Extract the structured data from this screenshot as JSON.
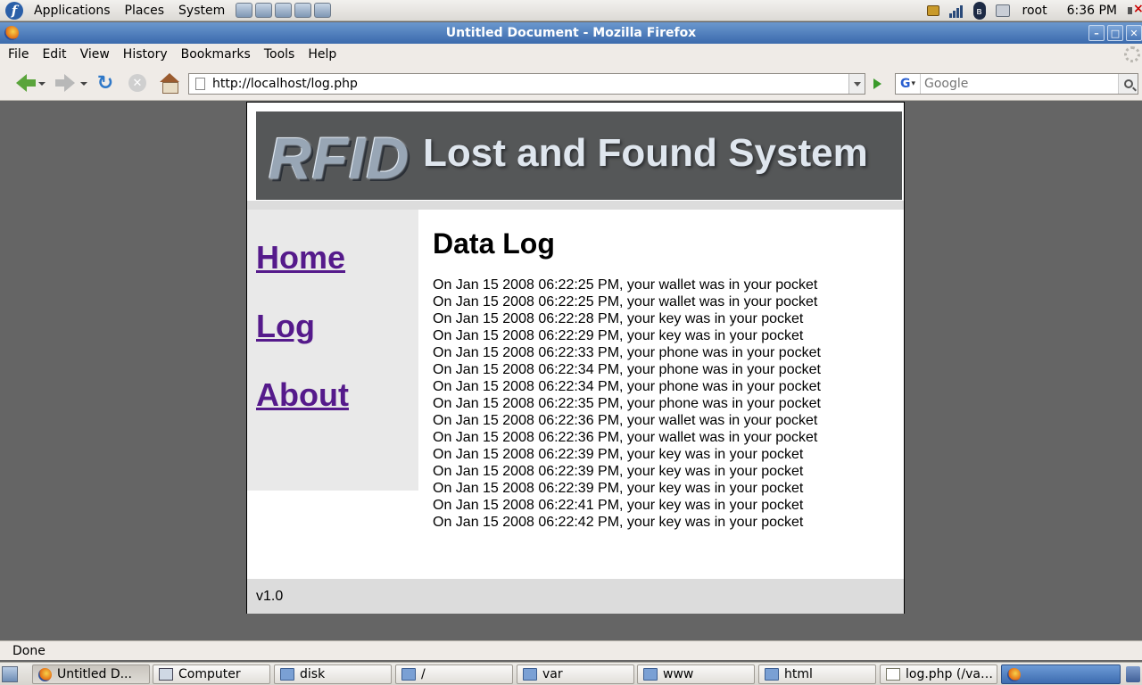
{
  "top_panel": {
    "menus": [
      "Applications",
      "Places",
      "System"
    ],
    "user": "root",
    "clock": "6:36 PM",
    "bluetooth_glyph": "ʙ"
  },
  "window": {
    "title": "Untitled Document - Mozilla Firefox",
    "controls": {
      "minimize": "–",
      "maximize": "□",
      "close": "✕"
    }
  },
  "menubar": {
    "items": [
      {
        "label": "File"
      },
      {
        "label": "Edit"
      },
      {
        "label": "View"
      },
      {
        "label": "History"
      },
      {
        "label": "Bookmarks"
      },
      {
        "label": "Tools"
      },
      {
        "label": "Help"
      }
    ]
  },
  "navbar": {
    "url": "http://localhost/log.php",
    "search_placeholder": "Google",
    "search_engine_glyph": "G",
    "reload_glyph": "↻",
    "stop_glyph": "✕"
  },
  "page": {
    "banner_logo": "RFID",
    "banner_title": "Lost and Found System",
    "nav": [
      "Home",
      "Log",
      "About"
    ],
    "heading": "Data Log",
    "log_entries": [
      "On Jan 15 2008 06:22:25 PM, your wallet was in your pocket",
      "On Jan 15 2008 06:22:25 PM, your wallet was in your pocket",
      "On Jan 15 2008 06:22:28 PM, your key was in your pocket",
      "On Jan 15 2008 06:22:29 PM, your key was in your pocket",
      "On Jan 15 2008 06:22:33 PM, your phone was in your pocket",
      "On Jan 15 2008 06:22:34 PM, your phone was in your pocket",
      "On Jan 15 2008 06:22:34 PM, your phone was in your pocket",
      "On Jan 15 2008 06:22:35 PM, your phone was in your pocket",
      "On Jan 15 2008 06:22:36 PM, your wallet was in your pocket",
      "On Jan 15 2008 06:22:36 PM, your wallet was in your pocket",
      "On Jan 15 2008 06:22:39 PM, your key was in your pocket",
      "On Jan 15 2008 06:22:39 PM, your key was in your pocket",
      "On Jan 15 2008 06:22:39 PM, your key was in your pocket",
      "On Jan 15 2008 06:22:41 PM, your key was in your pocket",
      "On Jan 15 2008 06:22:42 PM, your key was in your pocket"
    ],
    "footer": "v1.0"
  },
  "statusbar": {
    "text": "Done"
  },
  "taskbar": {
    "tasks": [
      {
        "label": "Untitled D...",
        "icon": "firefox-icon"
      },
      {
        "label": "Computer",
        "icon": "computer-icon"
      },
      {
        "label": "disk",
        "icon": "folder-icon"
      },
      {
        "label": "/",
        "icon": "folder-icon"
      },
      {
        "label": "var",
        "icon": "folder-icon"
      },
      {
        "label": "www",
        "icon": "folder-icon"
      },
      {
        "label": "html",
        "icon": "folder-icon"
      },
      {
        "label": "log.php (/var/...",
        "icon": "text-editor-icon"
      },
      {
        "label": "",
        "icon": "firefox-icon"
      }
    ]
  }
}
